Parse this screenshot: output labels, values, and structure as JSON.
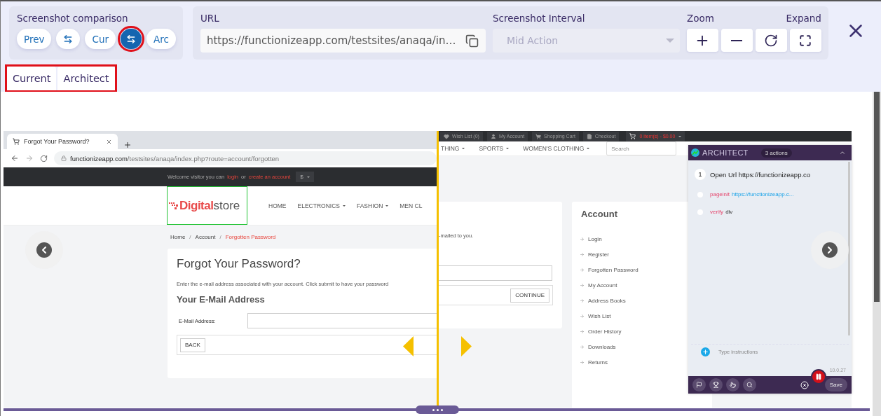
{
  "header": {
    "comparison": {
      "label": "Screenshot comparison",
      "buttons": [
        {
          "kind": "text",
          "label": "Prev",
          "selected": false,
          "highlighted": false
        },
        {
          "kind": "swap",
          "selected": false,
          "highlighted": false
        },
        {
          "kind": "text",
          "label": "Cur",
          "selected": false,
          "highlighted": false
        },
        {
          "kind": "swap",
          "selected": true,
          "highlighted": true
        },
        {
          "kind": "text",
          "label": "Arc",
          "selected": false,
          "highlighted": false
        }
      ]
    },
    "url": {
      "label": "URL",
      "value": "https://functionizeapp.com/testsites/anaqa/in…"
    },
    "interval": {
      "label": "Screenshot Interval",
      "value": "Mid Action",
      "disabled": true
    },
    "zoom": {
      "label": "Zoom"
    },
    "expand": {
      "label": "Expand"
    }
  },
  "tabs": {
    "highlighted": true,
    "items": [
      {
        "label": "Current",
        "selected": false
      },
      {
        "label": "Architect",
        "selected": false
      }
    ]
  },
  "current": {
    "browser_tab": "Forgot Your Password?",
    "address_host": "functionizeapp.com",
    "address_path": "/testsites/anaqa/index.php?route=account/forgotten",
    "welcome": [
      {
        "kind": "text",
        "text": "Welcome visitor you can"
      },
      {
        "kind": "link",
        "text": "login"
      },
      {
        "kind": "text",
        "text": "or"
      },
      {
        "kind": "link",
        "text": "create an account"
      }
    ],
    "currency": "$",
    "logo": {
      "first": "Digital",
      "second": "store"
    },
    "nav": [
      {
        "label": "HOME",
        "dropdown": false
      },
      {
        "label": "ELECTRONICS",
        "dropdown": true
      },
      {
        "label": "FASHION",
        "dropdown": true
      },
      {
        "label": "MEN CL",
        "dropdown": false
      }
    ],
    "breadcrumb": [
      {
        "kind": "crumb",
        "label": "Home",
        "current": false
      },
      {
        "kind": "separator",
        "label": "/"
      },
      {
        "kind": "crumb",
        "label": "Account",
        "current": false
      },
      {
        "kind": "separator",
        "label": "/"
      },
      {
        "kind": "crumb",
        "label": "Forgotten Password",
        "current": true
      }
    ],
    "heading": "Forgot Your Password?",
    "intro": "Enter the e-mail address associated with your account. Click submit to have your password",
    "section": "Your E-Mail Address",
    "field_label": "E-Mail Address:",
    "back": "BACK"
  },
  "architect_page": {
    "top_links": [
      "Wish List (0)",
      "My Account",
      "Shopping Cart",
      "Checkout"
    ],
    "cart": "0 item(s) - $0.00",
    "nav": [
      {
        "label": "THING",
        "dropdown": true
      },
      {
        "label": "SPORTS",
        "dropdown": true
      },
      {
        "label": "WOMEN'S CLOTHING",
        "dropdown": true
      }
    ],
    "search": {
      "placeholder": "Search"
    },
    "fragment": "-mailed to you.",
    "continue": "CONTINUE",
    "account_title": "Account",
    "account_links": [
      "Login",
      "Register",
      "Forgotten Password",
      "My Account",
      "Address Books",
      "Wish List",
      "Order History",
      "Downloads",
      "Returns"
    ]
  },
  "panel": {
    "title": "ARCHITECT",
    "count": "3 actions",
    "steps": [
      {
        "number": "1",
        "text": "Open Url https://functionizeapp.co",
        "children": [
          {
            "kind": "link",
            "keyword": "pageinit",
            "value": "https://functionizeapp.c..."
          },
          {
            "kind": "plain",
            "keyword": "verify",
            "value": "div"
          }
        ]
      }
    ],
    "input": {
      "placeholder": "Type instructions"
    },
    "version": "10.0.27",
    "save": "Save"
  }
}
